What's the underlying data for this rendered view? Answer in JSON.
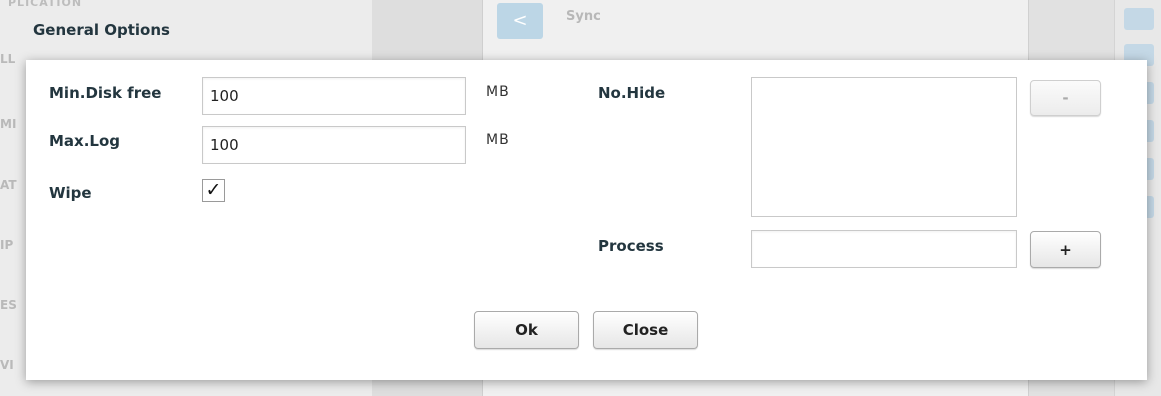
{
  "background": {
    "header_text": "PLICATION",
    "side_letters": [
      "LL",
      "MI",
      "AT",
      "IP",
      "ES",
      "VI"
    ],
    "sync_label": "Sync"
  },
  "dialog": {
    "title": "General Options",
    "min_disk_free": {
      "label": "Min.Disk free",
      "value": "100",
      "unit": "MB"
    },
    "max_log": {
      "label": "Max.Log",
      "value": "100",
      "unit": "MB"
    },
    "wipe": {
      "label": "Wipe",
      "checked": true,
      "check_glyph": "✓"
    },
    "no_hide": {
      "label": "No.Hide",
      "items": [],
      "remove_label": "-"
    },
    "process": {
      "label": "Process",
      "value": "",
      "add_label": "+"
    },
    "ok_label": "Ok",
    "close_label": "Close"
  }
}
